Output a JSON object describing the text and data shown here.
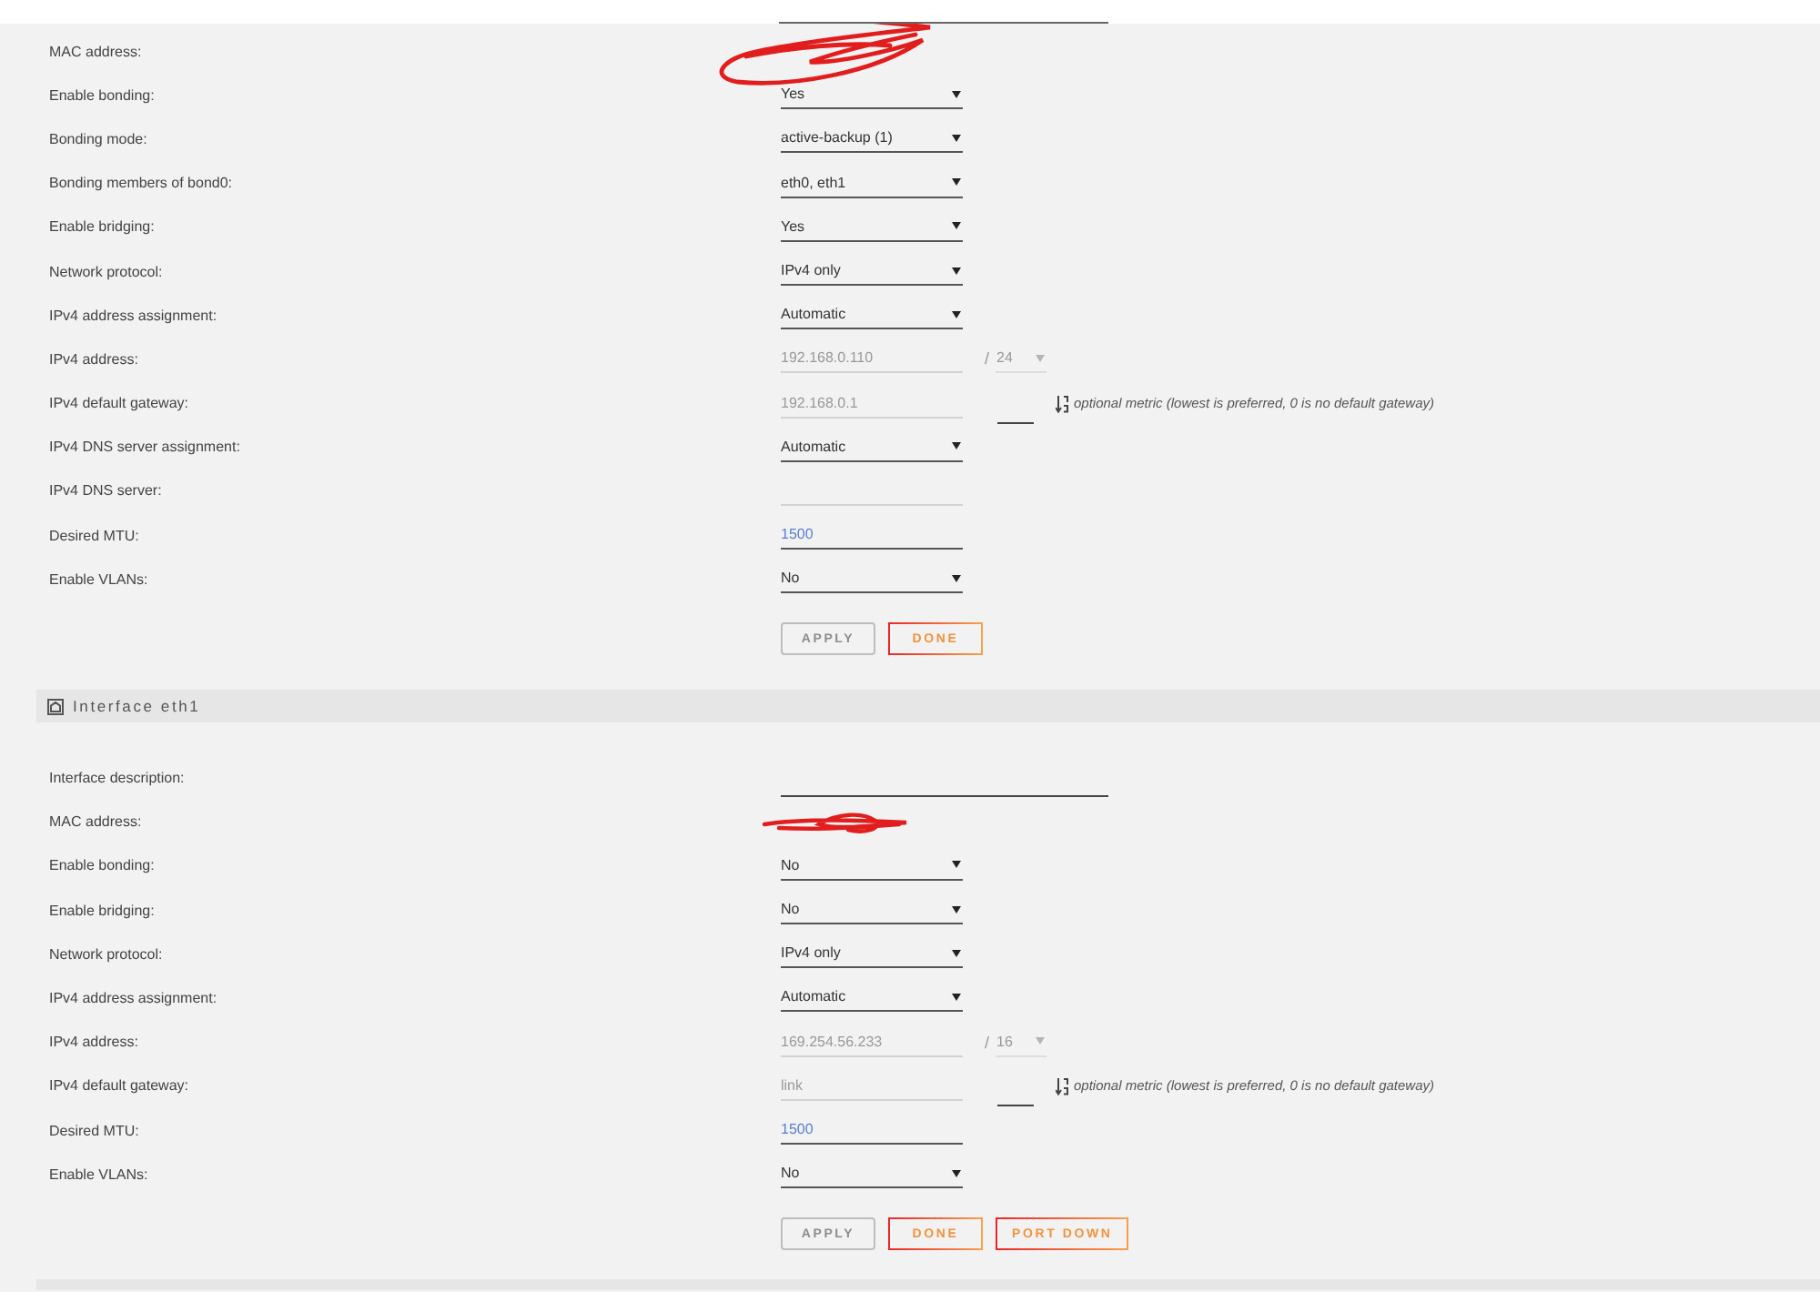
{
  "sections": [
    {
      "rows": [
        {
          "kind": "mac",
          "label": "MAC address:",
          "redacted": true
        },
        {
          "kind": "select",
          "label": "Enable bonding:",
          "value": "Yes"
        },
        {
          "kind": "select",
          "label": "Bonding mode:",
          "value": "active-backup (1)"
        },
        {
          "kind": "select",
          "label": "Bonding members of bond0:",
          "value": "eth0, eth1"
        },
        {
          "kind": "select",
          "label": "Enable bridging:",
          "value": "Yes"
        },
        {
          "kind": "select",
          "label": "Network protocol:",
          "value": "IPv4 only"
        },
        {
          "kind": "select",
          "label": "IPv4 address assignment:",
          "value": "Automatic"
        },
        {
          "kind": "address",
          "label": "IPv4 address:",
          "value": "192.168.0.110",
          "disabled": true,
          "separator": "/",
          "prefix": "24"
        },
        {
          "kind": "gateway",
          "label": "IPv4 default gateway:",
          "value": "192.168.0.1",
          "disabled": true,
          "hint": "optional metric (lowest is preferred, 0 is no default gateway)"
        },
        {
          "kind": "select",
          "label": "IPv4 DNS server assignment:",
          "value": "Automatic"
        },
        {
          "kind": "text",
          "label": "IPv4 DNS server:",
          "disabled": true
        },
        {
          "kind": "text",
          "label": "Desired MTU:",
          "value": "1500",
          "disabled": false
        },
        {
          "kind": "select",
          "label": "Enable VLANs:",
          "value": "No"
        }
      ],
      "buttons": [
        {
          "label": "APPLY",
          "disabled": true
        },
        {
          "label": "DONE",
          "disabled": false
        }
      ]
    },
    {
      "title": "Interface eth1",
      "rows": [
        {
          "kind": "wide_text",
          "label": "Interface description:"
        },
        {
          "kind": "mac",
          "label": "MAC address:",
          "redacted": true
        },
        {
          "kind": "select",
          "label": "Enable bonding:",
          "value": "No"
        },
        {
          "kind": "select",
          "label": "Enable bridging:",
          "value": "No"
        },
        {
          "kind": "select",
          "label": "Network protocol:",
          "value": "IPv4 only"
        },
        {
          "kind": "select",
          "label": "IPv4 address assignment:",
          "value": "Automatic"
        },
        {
          "kind": "address",
          "label": "IPv4 address:",
          "value": "169.254.56.233",
          "disabled": true,
          "separator": "/",
          "prefix": "16"
        },
        {
          "kind": "gateway",
          "label": "IPv4 default gateway:",
          "value": "link",
          "disabled": true,
          "hint": "optional metric (lowest is preferred, 0 is no default gateway)"
        },
        {
          "kind": "text",
          "label": "Desired MTU:",
          "value": "1500",
          "disabled": false
        },
        {
          "kind": "select",
          "label": "Enable VLANs:",
          "value": "No"
        }
      ],
      "buttons": [
        {
          "label": "APPLY",
          "disabled": true
        },
        {
          "label": "DONE",
          "disabled": false
        },
        {
          "label": "PORT DOWN",
          "disabled": false
        }
      ]
    }
  ]
}
